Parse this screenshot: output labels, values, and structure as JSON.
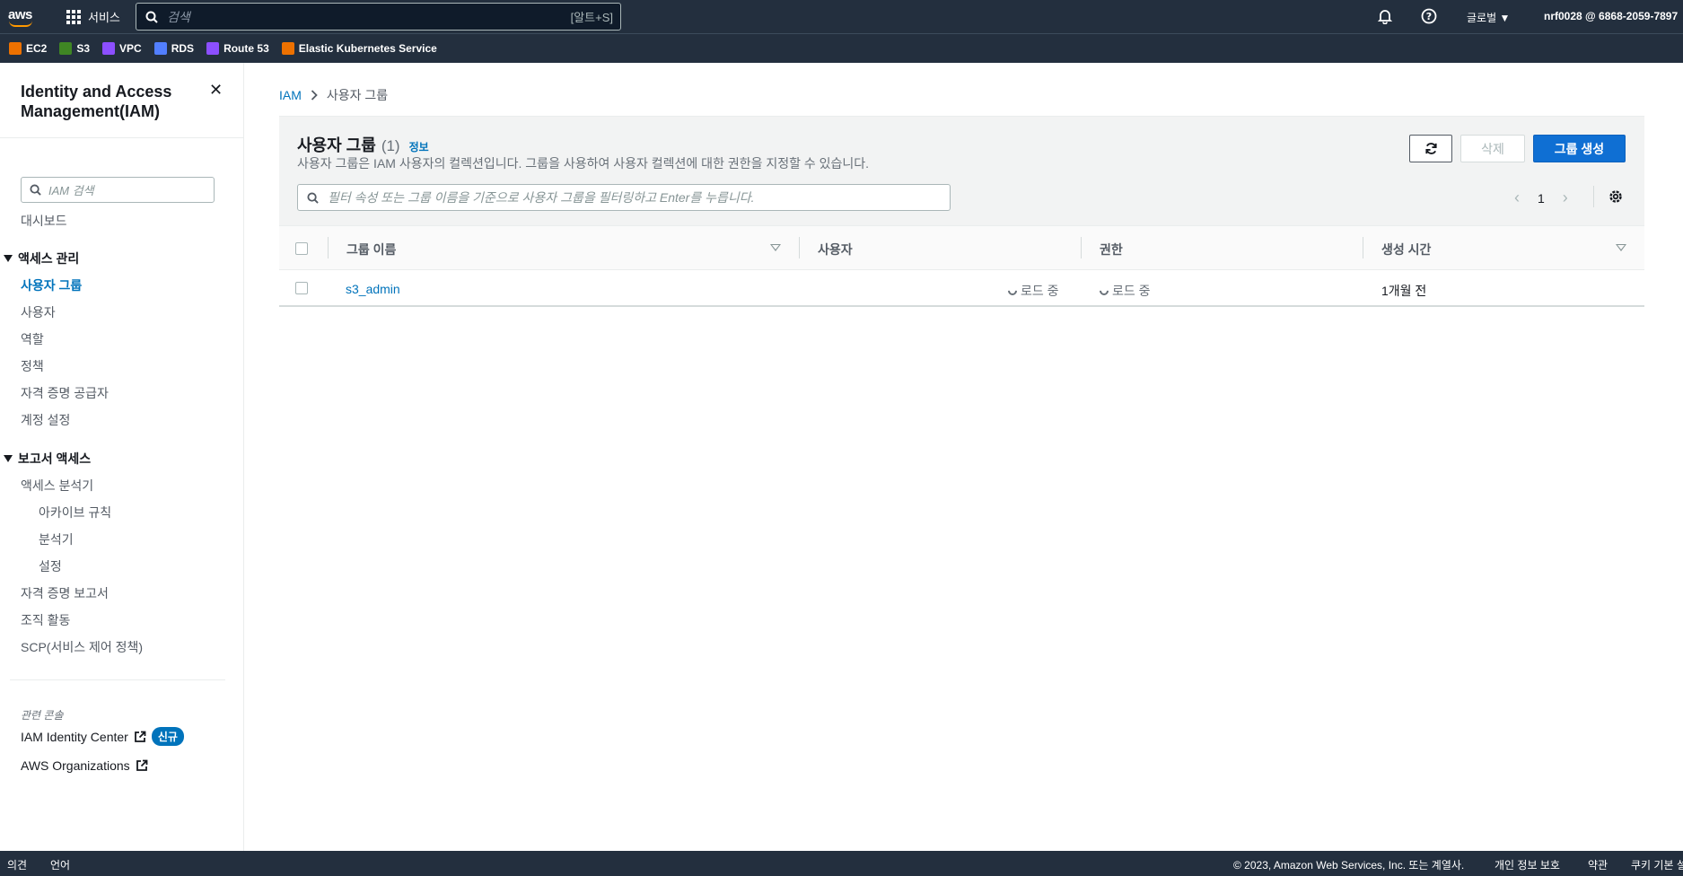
{
  "topnav": {
    "logo": "aws",
    "services_label": "서비스",
    "search_placeholder": "검색",
    "search_shortcut": "[알트+S]",
    "region_label": "글로벌 ▼",
    "account_label": "nrf0028 @ 6868-2059-7897"
  },
  "favorites": [
    {
      "label": "EC2",
      "icon": "ec2-icon",
      "color": "#ed7100"
    },
    {
      "label": "S3",
      "icon": "s3-icon",
      "color": "#3f8624"
    },
    {
      "label": "VPC",
      "icon": "vpc-icon",
      "color": "#8c4fff"
    },
    {
      "label": "RDS",
      "icon": "rds-icon",
      "color": "#527fff"
    },
    {
      "label": "Route 53",
      "icon": "route53-icon",
      "color": "#8c4fff"
    },
    {
      "label": "Elastic Kubernetes Service",
      "icon": "eks-icon",
      "color": "#ed7100"
    }
  ],
  "sidebar": {
    "title": "Identity and Access Management(IAM)",
    "search_placeholder": "IAM 검색",
    "dashboard": "대시보드",
    "section_access": "액세스 관리",
    "access_items": [
      "사용자 그룹",
      "사용자",
      "역할",
      "정책",
      "자격 증명 공급자",
      "계정 설정"
    ],
    "section_reports": "보고서 액세스",
    "report_items": [
      "액세스 분석기",
      "아카이브 규칙",
      "분석기",
      "설정",
      "자격 증명 보고서",
      "조직 활동",
      "SCP(서비스 제어 정책)"
    ],
    "related_label": "관련 콘솔",
    "identity_center": "IAM Identity Center",
    "new_badge": "신규",
    "organizations": "AWS Organizations"
  },
  "breadcrumb": {
    "root": "IAM",
    "current": "사용자 그룹"
  },
  "panel": {
    "title": "사용자 그룹",
    "count": "(1)",
    "info": "정보",
    "description": "사용자 그룹은 IAM 사용자의 컬렉션입니다. 그룹을 사용하여 사용자 컬렉션에 대한 권한을 지정할 수 있습니다.",
    "delete_label": "삭제",
    "create_label": "그룹 생성",
    "filter_placeholder": "필터 속성 또는 그룹 이름을 기준으로 사용자 그룹을 필터링하고 Enter를 누릅니다.",
    "page_number": "1"
  },
  "table": {
    "columns": [
      "그룹 이름",
      "사용자",
      "권한",
      "생성 시간"
    ],
    "rows": [
      {
        "name": "s3_admin",
        "users": "로드 중",
        "permissions": "로드 중",
        "created": "1개월 전"
      }
    ]
  },
  "footer": {
    "feedback": "의견",
    "language": "언어",
    "copyright": "© 2023, Amazon Web Services, Inc. 또는 계열사.",
    "privacy": "개인 정보 보호",
    "terms": "약관",
    "cookies": "쿠키 기본 설정"
  }
}
